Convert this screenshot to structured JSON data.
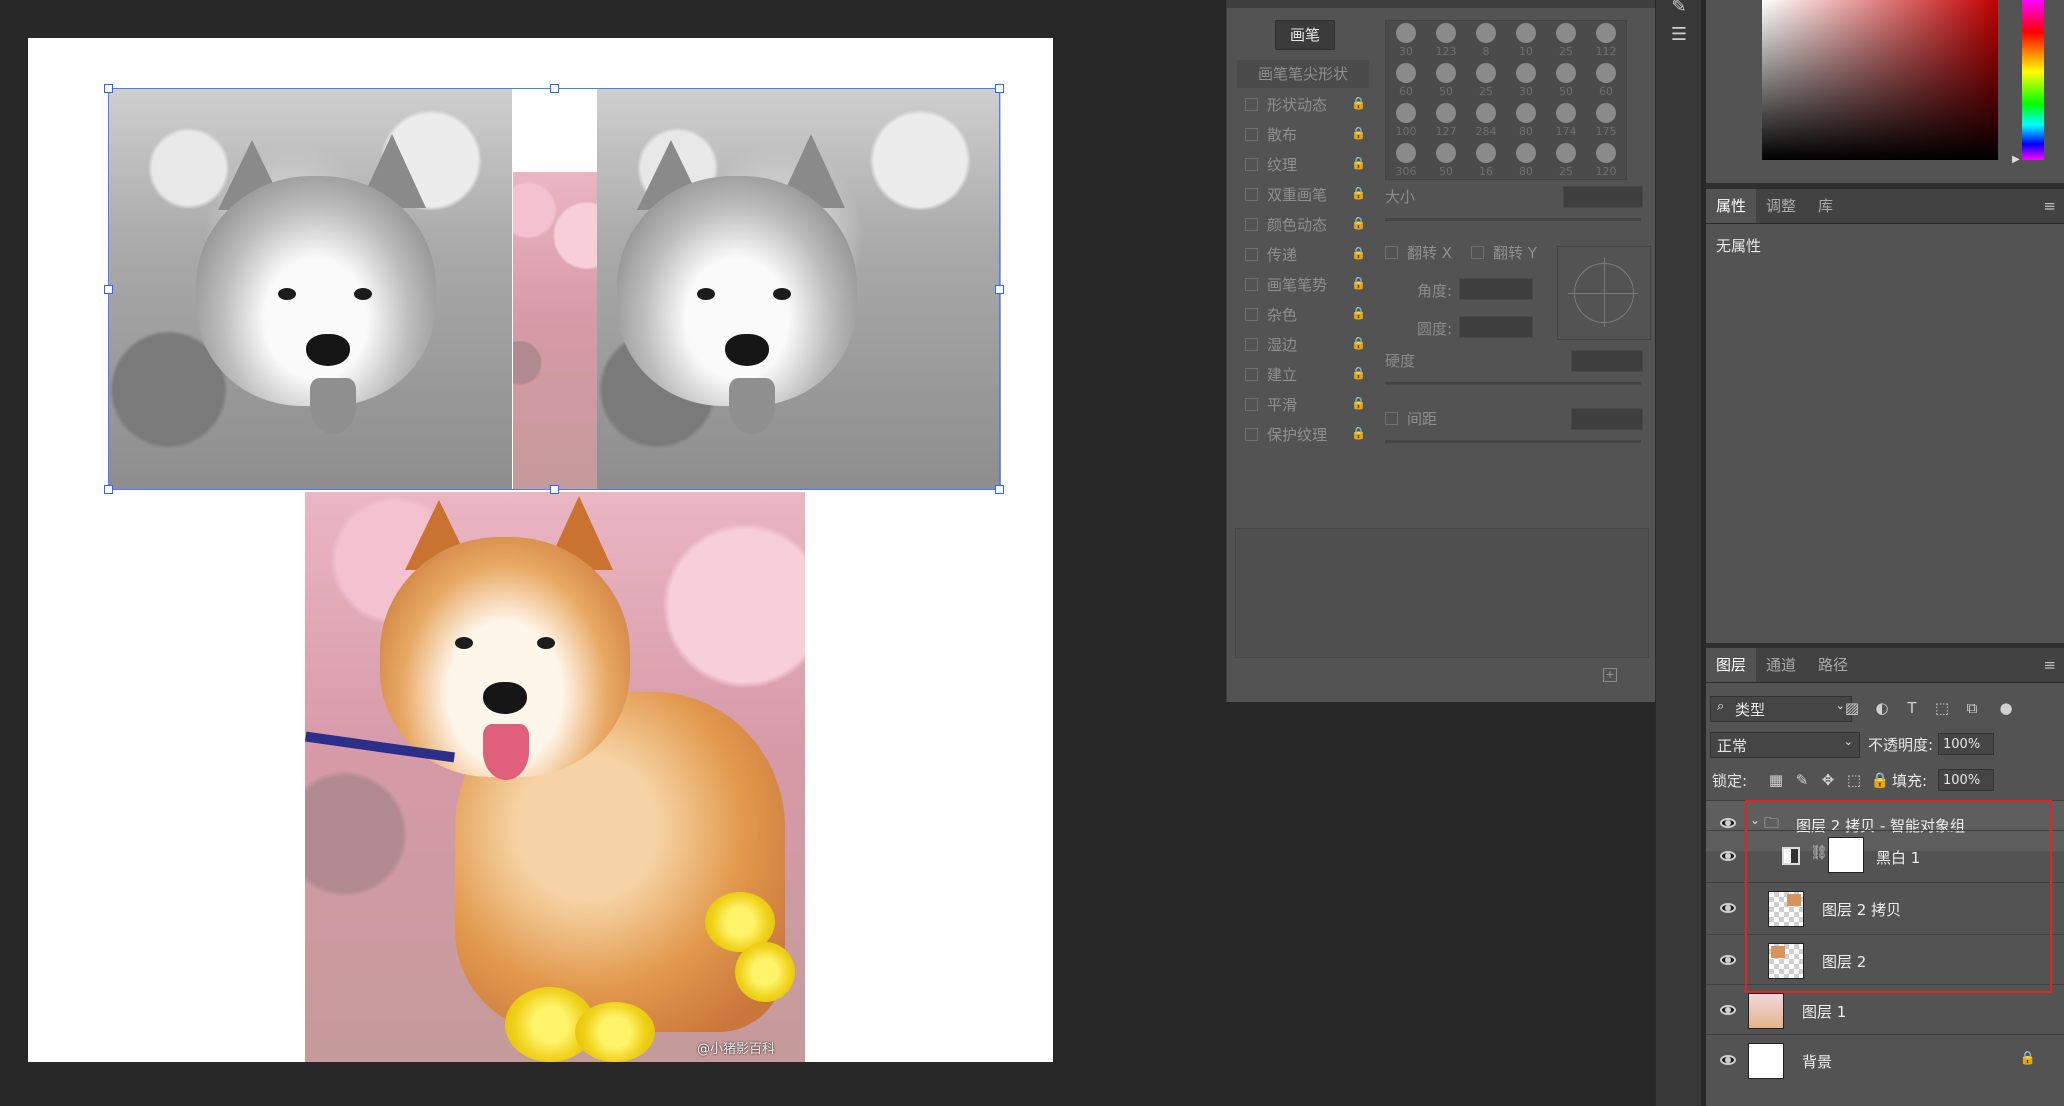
{
  "canvas": {
    "watermark": "@小猪影百科"
  },
  "brush_panel": {
    "brush_button": "画笔",
    "tip_shape_label": "画笔笔尖形状",
    "options": [
      {
        "label": "形状动态"
      },
      {
        "label": "散布"
      },
      {
        "label": "纹理"
      },
      {
        "label": "双重画笔"
      },
      {
        "label": "颜色动态"
      },
      {
        "label": "传递"
      },
      {
        "label": "画笔笔势"
      },
      {
        "label": "杂色"
      },
      {
        "label": "湿边"
      },
      {
        "label": "建立"
      },
      {
        "label": "平滑"
      },
      {
        "label": "保护纹理"
      }
    ],
    "brush_sizes": [
      "30",
      "123",
      "8",
      "10",
      "25",
      "112",
      "60",
      "50",
      "25",
      "30",
      "50",
      "60",
      "100",
      "127",
      "284",
      "80",
      "174",
      "175",
      "306",
      "50",
      "16",
      "80",
      "25",
      "120"
    ],
    "size_label": "大小",
    "flip_x_label": "翻转 X",
    "flip_y_label": "翻转 Y",
    "angle_label": "角度:",
    "roundness_label": "圆度:",
    "hardness_label": "硬度",
    "spacing_label": "间距"
  },
  "properties_panel": {
    "tabs": [
      "属性",
      "调整",
      "库"
    ],
    "active_tab": "属性",
    "body_text": "无属性"
  },
  "layers_panel": {
    "tabs": [
      "图层",
      "通道",
      "路径"
    ],
    "active_tab": "图层",
    "filter_value": "类型",
    "blend_mode": "正常",
    "opacity_label": "不透明度:",
    "opacity_value": "100%",
    "lock_label": "锁定:",
    "fill_label": "填充:",
    "fill_value": "100%",
    "layers": [
      {
        "name": "图层 2 拷贝 - 智能对象组",
        "kind": "group"
      },
      {
        "name": "黑白 1",
        "kind": "adjustment"
      },
      {
        "name": "图层 2 拷贝",
        "kind": "pixel"
      },
      {
        "name": "图层 2",
        "kind": "pixel"
      },
      {
        "name": "图层 1",
        "kind": "pixel"
      },
      {
        "name": "背景",
        "kind": "background",
        "locked": true
      }
    ]
  },
  "colors": {
    "highlight": "#e0242a",
    "selection": "#4a7dff"
  }
}
